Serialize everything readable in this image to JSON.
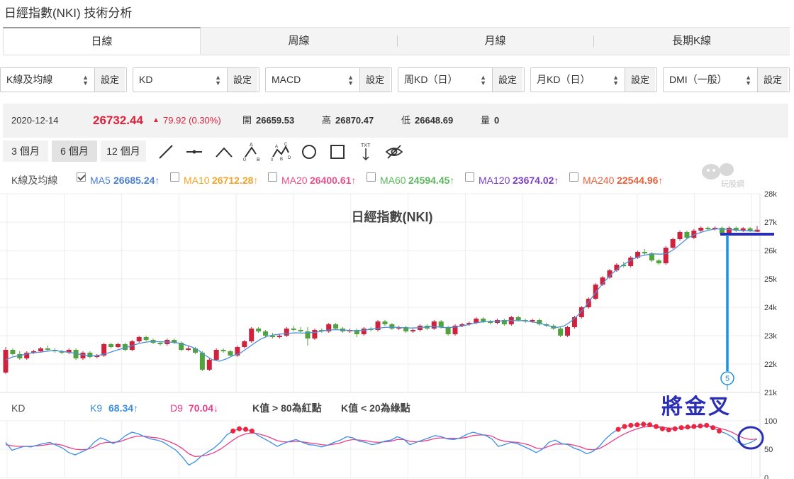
{
  "page": {
    "title": "日經指數(NKI) 技術分析"
  },
  "tabs": [
    {
      "label": "日線",
      "active": true
    },
    {
      "label": "周線",
      "active": false
    },
    {
      "label": "月線",
      "active": false
    },
    {
      "label": "長期K線",
      "active": false
    }
  ],
  "selectors": [
    {
      "value": "K線及均線",
      "button": "設定"
    },
    {
      "value": "KD",
      "button": "設定"
    },
    {
      "value": "MACD",
      "button": "設定"
    },
    {
      "value": "周KD（日）",
      "button": "設定"
    },
    {
      "value": "月KD（日）",
      "button": "設定"
    },
    {
      "value": "DMI（一般）",
      "button": "設定"
    }
  ],
  "quote": {
    "date": "2020-12-14",
    "price": "26732.44",
    "change": "79.92 (0.30%)",
    "open_label": "開",
    "open": "26659.53",
    "high_label": "高",
    "high": "26870.47",
    "low_label": "低",
    "low": "26648.69",
    "vol_label": "量",
    "vol": "0"
  },
  "ranges": [
    {
      "label": "3 個月",
      "active": false
    },
    {
      "label": "6 個月",
      "active": true
    },
    {
      "label": "12 個月",
      "active": false
    }
  ],
  "tools": [
    "line-tool-icon",
    "horizontal-line-icon",
    "trend-tool-icon",
    "abc-pattern-icon",
    "abcd-pattern-icon",
    "circle-tool-icon",
    "rectangle-tool-icon",
    "text-tool-icon",
    "hide-drawings-icon"
  ],
  "tool_text": {
    "text": "TXT",
    "abc": [
      "A",
      "B",
      "0"
    ],
    "abcd": [
      "A",
      "B",
      "C",
      "D",
      "0"
    ]
  },
  "ma_legend": {
    "label": "K線及均線",
    "items": [
      {
        "name": "MA5",
        "value": "26685.24↑",
        "color": "#4a7fd6",
        "checked": true
      },
      {
        "name": "MA10",
        "value": "26712.28↑",
        "color": "#f2a42a",
        "checked": false
      },
      {
        "name": "MA20",
        "value": "26400.61↑",
        "color": "#e8508a",
        "checked": false
      },
      {
        "name": "MA60",
        "value": "24594.45↑",
        "color": "#5cb85c",
        "checked": false
      },
      {
        "name": "MA120",
        "value": "23674.02↑",
        "color": "#7a3fc4",
        "checked": false
      },
      {
        "name": "MA240",
        "value": "22544.96↑",
        "color": "#e8603a",
        "checked": false
      }
    ]
  },
  "watermark": {
    "text": "玩股網"
  },
  "kd_legend": {
    "label": "KD",
    "k_name": "K9",
    "k_value": "68.34↑",
    "d_name": "D9",
    "d_value": "70.04↓",
    "note_red": "K值 > 80為紅點",
    "note_green": "K值 < 20為綠點"
  },
  "annotation": {
    "text": "將金叉",
    "marker": "5"
  },
  "colors": {
    "up": "#d2213c",
    "down": "#4fa53b",
    "ma5": "#4a90d9",
    "k": "#3a8ee6",
    "d": "#e8408a",
    "annot": "#2b2fb5"
  },
  "chart_data": [
    {
      "type": "candlestick",
      "title": "日經指數(NKI)",
      "ylim": [
        21000,
        28000
      ],
      "y_ticks": [
        "21k",
        "22k",
        "23k",
        "24k",
        "25k",
        "26k",
        "27k",
        "28k"
      ],
      "ma5_last": 26685.24,
      "candles": [
        [
          21700,
          22500,
          21650,
          22600
        ],
        [
          22500,
          22350,
          22300,
          22550
        ],
        [
          22350,
          22200,
          22150,
          22450
        ],
        [
          22200,
          22400,
          22150,
          22450
        ],
        [
          22400,
          22450,
          22350,
          22500
        ],
        [
          22450,
          22550,
          22400,
          22600
        ],
        [
          22550,
          22500,
          22450,
          22650
        ],
        [
          22500,
          22450,
          22400,
          22550
        ],
        [
          22450,
          22400,
          22350,
          22500
        ],
        [
          22400,
          22500,
          22350,
          22550
        ],
        [
          22500,
          22200,
          22150,
          22550
        ],
        [
          22200,
          22400,
          22150,
          22450
        ],
        [
          22400,
          22250,
          22200,
          22450
        ],
        [
          22250,
          22300,
          22200,
          22350
        ],
        [
          22300,
          22700,
          22250,
          22750
        ],
        [
          22700,
          22600,
          22550,
          22750
        ],
        [
          22600,
          22700,
          22550,
          22750
        ],
        [
          22700,
          22500,
          22450,
          22750
        ],
        [
          22500,
          22800,
          22450,
          22850
        ],
        [
          22800,
          22950,
          22750,
          23000
        ],
        [
          22950,
          22850,
          22800,
          23000
        ],
        [
          22850,
          22750,
          22700,
          22900
        ],
        [
          22750,
          22700,
          22650,
          22800
        ],
        [
          22700,
          22850,
          22650,
          22900
        ],
        [
          22850,
          22750,
          22700,
          22900
        ],
        [
          22750,
          22500,
          22450,
          22800
        ],
        [
          22500,
          22550,
          22450,
          22650
        ],
        [
          22550,
          22400,
          22350,
          22600
        ],
        [
          22400,
          21800,
          21750,
          22450
        ],
        [
          21800,
          22150,
          21750,
          22200
        ],
        [
          22150,
          22500,
          22100,
          22550
        ],
        [
          22500,
          22450,
          22400,
          22550
        ],
        [
          22450,
          22300,
          22250,
          22500
        ],
        [
          22300,
          22600,
          22250,
          22650
        ],
        [
          22600,
          22800,
          22550,
          22850
        ],
        [
          22800,
          23250,
          22750,
          23300
        ],
        [
          23250,
          23150,
          23100,
          23300
        ],
        [
          23150,
          23000,
          22950,
          23200
        ],
        [
          23000,
          22950,
          22900,
          23100
        ],
        [
          22950,
          23000,
          22900,
          23050
        ],
        [
          23000,
          23250,
          22950,
          23300
        ],
        [
          23250,
          23200,
          23150,
          23350
        ],
        [
          23200,
          23150,
          23100,
          23300
        ],
        [
          23150,
          22900,
          22650,
          23300
        ],
        [
          22900,
          23200,
          22850,
          23250
        ],
        [
          23200,
          23150,
          23100,
          23250
        ],
        [
          23150,
          23400,
          23100,
          23450
        ],
        [
          23400,
          23250,
          23200,
          23450
        ],
        [
          23250,
          23150,
          23100,
          23300
        ],
        [
          23150,
          23200,
          23100,
          23250
        ],
        [
          23200,
          23050,
          22950,
          23250
        ],
        [
          23050,
          23250,
          23000,
          23300
        ],
        [
          23250,
          23200,
          23150,
          23300
        ],
        [
          23200,
          23500,
          23150,
          23550
        ],
        [
          23500,
          23400,
          23350,
          23550
        ],
        [
          23400,
          23250,
          23200,
          23450
        ],
        [
          23250,
          23300,
          23200,
          23350
        ],
        [
          23300,
          23150,
          23100,
          23350
        ],
        [
          23150,
          23200,
          23100,
          23250
        ],
        [
          23200,
          23350,
          23150,
          23400
        ],
        [
          23350,
          23250,
          23200,
          23400
        ],
        [
          23250,
          23500,
          23200,
          23550
        ],
        [
          23500,
          23300,
          23250,
          23550
        ],
        [
          23300,
          23050,
          23000,
          23350
        ],
        [
          23050,
          23350,
          23000,
          23400
        ],
        [
          23350,
          23400,
          23300,
          23450
        ],
        [
          23400,
          23450,
          23350,
          23500
        ],
        [
          23450,
          23600,
          23400,
          23650
        ],
        [
          23600,
          23500,
          23450,
          23650
        ],
        [
          23500,
          23450,
          23400,
          23550
        ],
        [
          23450,
          23550,
          23400,
          23600
        ],
        [
          23550,
          23400,
          23350,
          23600
        ],
        [
          23400,
          23650,
          23350,
          23700
        ],
        [
          23650,
          23550,
          23500,
          23700
        ],
        [
          23550,
          23500,
          23450,
          23600
        ],
        [
          23500,
          23550,
          23450,
          23600
        ],
        [
          23550,
          23400,
          23350,
          23600
        ],
        [
          23400,
          23350,
          23300,
          23450
        ],
        [
          23350,
          23250,
          23200,
          23400
        ],
        [
          23250,
          23000,
          22950,
          23300
        ],
        [
          23000,
          23300,
          22950,
          23350
        ],
        [
          23300,
          23650,
          23250,
          23700
        ],
        [
          23650,
          24000,
          23600,
          24050
        ],
        [
          24000,
          24300,
          23950,
          24350
        ],
        [
          24300,
          24800,
          24250,
          24850
        ],
        [
          24800,
          25050,
          24750,
          25100
        ],
        [
          25050,
          25300,
          25000,
          25350
        ],
        [
          25300,
          25500,
          25250,
          25550
        ],
        [
          25500,
          25450,
          25400,
          25600
        ],
        [
          25450,
          25750,
          25400,
          25800
        ],
        [
          25750,
          25950,
          25700,
          26000
        ],
        [
          25950,
          25900,
          25850,
          26050
        ],
        [
          25900,
          25650,
          25600,
          25950
        ],
        [
          25650,
          25550,
          25500,
          25700
        ],
        [
          25550,
          26100,
          25500,
          26150
        ],
        [
          26100,
          26400,
          26050,
          26450
        ],
        [
          26400,
          26650,
          26350,
          26700
        ],
        [
          26650,
          26450,
          26400,
          26700
        ],
        [
          26450,
          26700,
          26400,
          26750
        ],
        [
          26700,
          26800,
          26650,
          26850
        ],
        [
          26800,
          26750,
          26700,
          26850
        ],
        [
          26750,
          26800,
          26700,
          26850
        ],
        [
          26800,
          26600,
          26550,
          26850
        ],
        [
          26600,
          26800,
          26550,
          26850
        ],
        [
          26800,
          26700,
          26650,
          26850
        ],
        [
          26700,
          26780,
          26650,
          26830
        ],
        [
          26780,
          26700,
          26650,
          26830
        ],
        [
          26660,
          26732,
          26648,
          26870
        ]
      ],
      "ma5": [
        22150,
        22250,
        22300,
        22350,
        22400,
        22420,
        22450,
        22480,
        22450,
        22420,
        22380,
        22330,
        22300,
        22290,
        22330,
        22400,
        22480,
        22550,
        22620,
        22700,
        22760,
        22790,
        22790,
        22780,
        22770,
        22740,
        22680,
        22600,
        22480,
        22300,
        22150,
        22100,
        22180,
        22300,
        22380,
        22550,
        22720,
        22880,
        22980,
        23030,
        23060,
        23080,
        23100,
        23090,
        23100,
        23120,
        23170,
        23200,
        23210,
        23200,
        23180,
        23170,
        23190,
        23230,
        23260,
        23290,
        23300,
        23290,
        23270,
        23270,
        23280,
        23310,
        23320,
        23300,
        23280,
        23300,
        23330,
        23380,
        23440,
        23480,
        23500,
        23510,
        23520,
        23530,
        23530,
        23530,
        23500,
        23460,
        23400,
        23330,
        23290,
        23340,
        23500,
        23720,
        24000,
        24330,
        24650,
        24950,
        25200,
        25400,
        25560,
        25700,
        25800,
        25850,
        25880,
        25870,
        25900,
        26050,
        26250,
        26450,
        26570,
        26650,
        26720,
        26760,
        26760,
        26740,
        26720,
        26700,
        26690,
        26685
      ]
    },
    {
      "type": "line",
      "title": "KD",
      "ylim": [
        0,
        100
      ],
      "y_ticks": [
        "0",
        "50",
        "100"
      ],
      "series": [
        {
          "name": "K9",
          "values": [
            62,
            48,
            52,
            55,
            54,
            57,
            60,
            62,
            57,
            52,
            44,
            40,
            45,
            50,
            62,
            70,
            66,
            60,
            65,
            74,
            80,
            77,
            72,
            68,
            66,
            62,
            55,
            48,
            36,
            22,
            28,
            38,
            45,
            52,
            62,
            75,
            82,
            86,
            85,
            82,
            74,
            68,
            62,
            55,
            60,
            64,
            67,
            62,
            58,
            57,
            54,
            57,
            62,
            66,
            72,
            70,
            64,
            62,
            58,
            60,
            64,
            66,
            72,
            68,
            58,
            62,
            66,
            70,
            74,
            72,
            68,
            67,
            70,
            76,
            80,
            77,
            74,
            68,
            55,
            58,
            62,
            60,
            55,
            50,
            44,
            50,
            62,
            66,
            60,
            58,
            52,
            48,
            42,
            46,
            55,
            68,
            78,
            85,
            90,
            92,
            93,
            94,
            93,
            90,
            86,
            84,
            86,
            88,
            89,
            90,
            91,
            92,
            88,
            82,
            78,
            72,
            62,
            58,
            62,
            68
          ]
        },
        {
          "name": "D9",
          "values": [
            58,
            56,
            55,
            55,
            55,
            56,
            57,
            59,
            59,
            57,
            53,
            50,
            49,
            50,
            54,
            60,
            62,
            62,
            63,
            67,
            71,
            73,
            73,
            71,
            70,
            67,
            63,
            58,
            51,
            42,
            37,
            38,
            40,
            44,
            50,
            58,
            66,
            73,
            77,
            79,
            77,
            74,
            70,
            65,
            63,
            63,
            64,
            63,
            61,
            60,
            58,
            57,
            59,
            61,
            65,
            67,
            66,
            65,
            63,
            62,
            63,
            64,
            67,
            67,
            64,
            63,
            64,
            66,
            69,
            70,
            69,
            69,
            69,
            71,
            74,
            75,
            75,
            73,
            67,
            64,
            63,
            62,
            60,
            57,
            52,
            51,
            55,
            59,
            59,
            59,
            57,
            54,
            50,
            49,
            51,
            57,
            64,
            71,
            77,
            82,
            86,
            89,
            90,
            90,
            89,
            87,
            87,
            87,
            88,
            89,
            90,
            91,
            90,
            87,
            84,
            80,
            74,
            69,
            67,
            68
          ]
        }
      ]
    }
  ]
}
